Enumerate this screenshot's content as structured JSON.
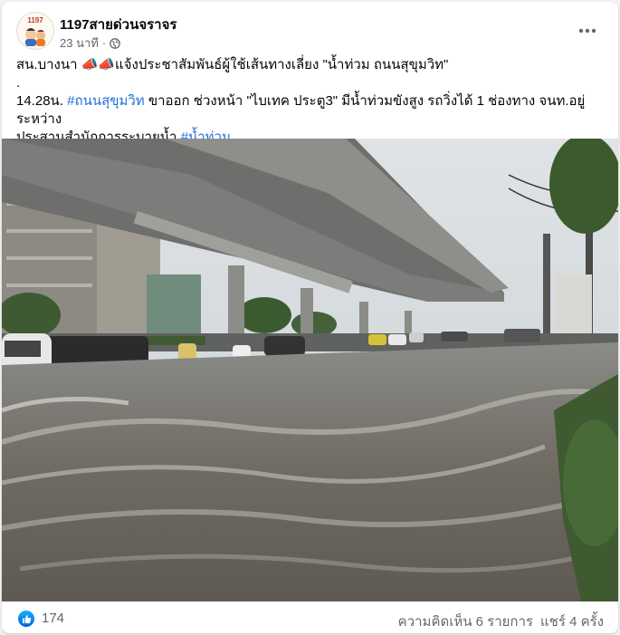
{
  "post": {
    "author": "1197สายด่วนจราจร",
    "time": "23 นาที",
    "dot": "·",
    "privacy_icon": "globe-icon",
    "avatar_text": "1197",
    "more_icon": "more-options-icon",
    "line1": "สน.บางนา 📣📣แจ้งประชาสัมพันธ์ผู้ใช้เส้นทางเลี่ยง \"น้ำท่วม ถนนสุขุมวิท\"",
    "line2": ".",
    "line3_prefix": "14.28น. ",
    "hashtag_road": "#ถนนสุขุมวิท",
    "line3_rest": " ขาออก ช่วงหน้า \"ไบเทค ประตู3\" มีน้ำท่วมขังสูง รถวิ่งได้ 1 ช่องทาง จนท.อยู่ระหว่าง",
    "line4_prefix": "ประสานสำนักการระบายน้ำ ",
    "hashtag_flood": "#น้ำท่วม"
  },
  "footer": {
    "like_icon": "like-icon",
    "likes": "174",
    "comments": "ความคิดเห็น 6 รายการ",
    "shares": "แชร์ 4 ครั้ง"
  },
  "colors": {
    "link": "#216fdb",
    "muted": "#65676b"
  }
}
